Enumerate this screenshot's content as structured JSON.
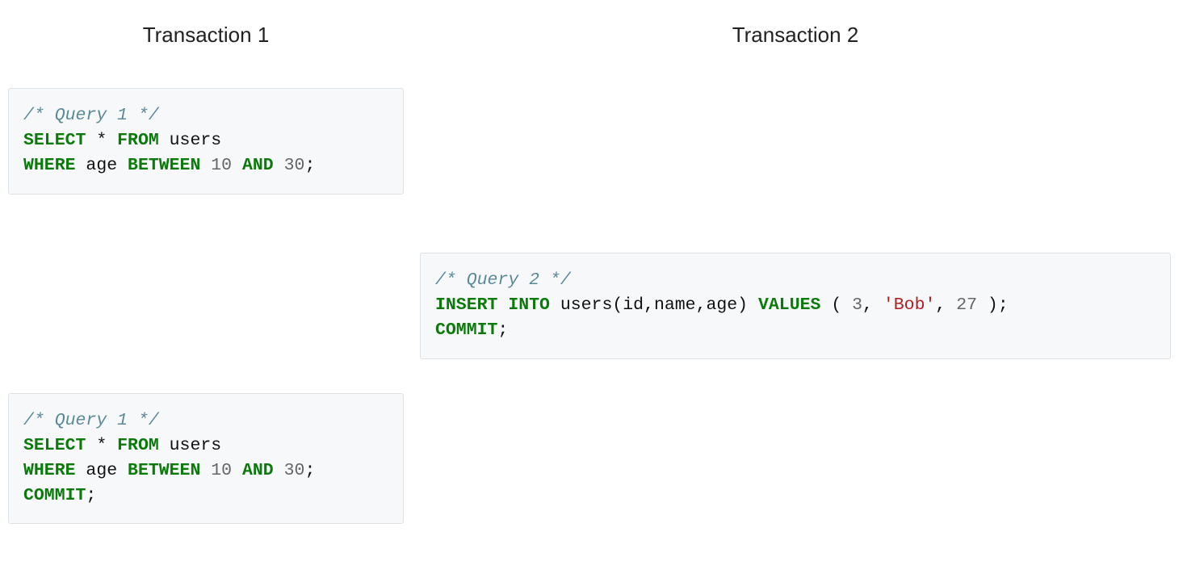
{
  "headings": {
    "left": "Transaction 1",
    "right": "Transaction 2"
  },
  "blocks": {
    "q1a": {
      "comment": "/* Query 1 */",
      "line2": {
        "kw1": "SELECT",
        "star": "*",
        "kw2": "FROM",
        "tbl": "users"
      },
      "line3": {
        "kw1": "WHERE",
        "col": "age",
        "kw2": "BETWEEN",
        "n1": "10",
        "kw3": "AND",
        "n2": "30",
        "punc": ";"
      }
    },
    "q2": {
      "comment": "/* Query 2 */",
      "line2": {
        "kw1": "INSERT",
        "kw2": "INTO",
        "tbl": "users",
        "cols": "(id,name,age)",
        "kw3": "VALUES",
        "lp": "(",
        "n1": "3",
        "c1": ",",
        "str": "'Bob'",
        "c2": ",",
        "n2": "27",
        "rp": ")",
        "punc": ";"
      },
      "line3": {
        "kw1": "COMMIT",
        "punc": ";"
      }
    },
    "q1b": {
      "comment": "/* Query 1 */",
      "line2": {
        "kw1": "SELECT",
        "star": "*",
        "kw2": "FROM",
        "tbl": "users"
      },
      "line3": {
        "kw1": "WHERE",
        "col": "age",
        "kw2": "BETWEEN",
        "n1": "10",
        "kw3": "AND",
        "n2": "30",
        "punc": ";"
      },
      "line4": {
        "kw1": "COMMIT",
        "punc": ";"
      }
    }
  }
}
